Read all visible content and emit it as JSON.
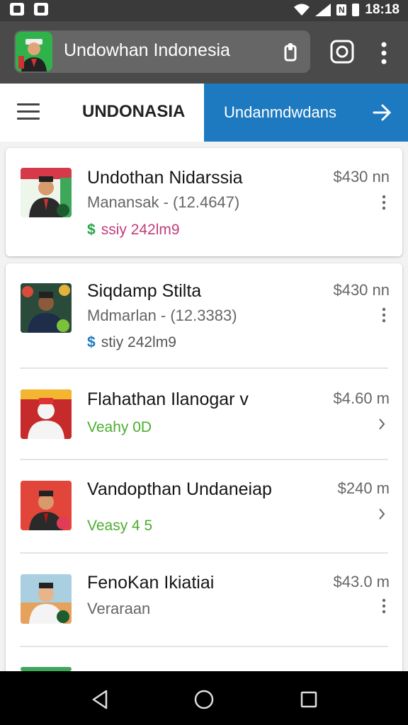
{
  "status_bar": {
    "time": "18:18",
    "network_badge": "N"
  },
  "app_bar": {
    "title": "Undowhan Indonesia",
    "icons": [
      "app-logo",
      "clip-icon",
      "instagram-icon",
      "more-vert-icon"
    ]
  },
  "tabs": {
    "brand": "UNDONASIA",
    "active_label": "Undanmdwdans",
    "menu_icon": "hamburger-icon",
    "active_icon": "arrow-right-icon"
  },
  "items": [
    {
      "name": "Undothan Nidarssia",
      "subtitle": "Manansak - (12.4647)",
      "meta_symbol": "$",
      "meta_text": "ssiy 242lm9",
      "price": "$430 nn",
      "trailing": "more-vert-icon"
    },
    {
      "name": "Siqdamp Stilta",
      "subtitle": "Mdmarlan - (12.3383)",
      "meta_symbol": "$",
      "meta_text": "stiy 242lm9",
      "price": "$430 nn",
      "trailing": "more-vert-icon"
    },
    {
      "name": "Flahathan Ilanogar v",
      "status": "Veahy 0D",
      "price": "$4.60 m",
      "trailing": "chevron-icon"
    },
    {
      "name": "Vandopthan Undaneiap",
      "status": "Veasy 4 5",
      "price": "$240 m",
      "trailing": "chevron-icon"
    },
    {
      "name": "FenoKan Ikiatiai",
      "subtitle": "Veraraan",
      "price": "$43.0 m",
      "trailing": "more-vert-icon"
    }
  ],
  "colors": {
    "status_bar": "#3a3a3a",
    "app_bar": "#4a4a4a",
    "accent": "#1e7ac0",
    "green": "#4bae2f",
    "dollar_green": "#25a545",
    "dollar_blue": "#1e7ac0"
  },
  "nav_bar": {
    "icons": [
      "back-icon",
      "home-icon",
      "recents-icon"
    ]
  }
}
